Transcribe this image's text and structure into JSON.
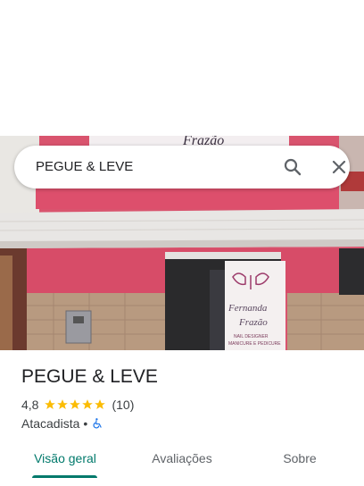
{
  "search": {
    "query": "PEGUE & LEVE"
  },
  "photo": {
    "sign_text": "Fernanda Frazão",
    "sign_subtext": "NAIL DESIGNER MANICURE E PEDICURE"
  },
  "place": {
    "name": "PEGUE & LEVE",
    "rating": "4,8",
    "stars": 5,
    "review_count": "(10)",
    "category": "Atacadista",
    "separator": "•"
  },
  "tabs": [
    {
      "label": "Visão geral",
      "active": true
    },
    {
      "label": "Avaliações",
      "active": false
    },
    {
      "label": "Sobre",
      "active": false
    }
  ],
  "colors": {
    "accent": "#00796b",
    "star": "#fbbc04",
    "wheelchair": "#1a73e8"
  }
}
